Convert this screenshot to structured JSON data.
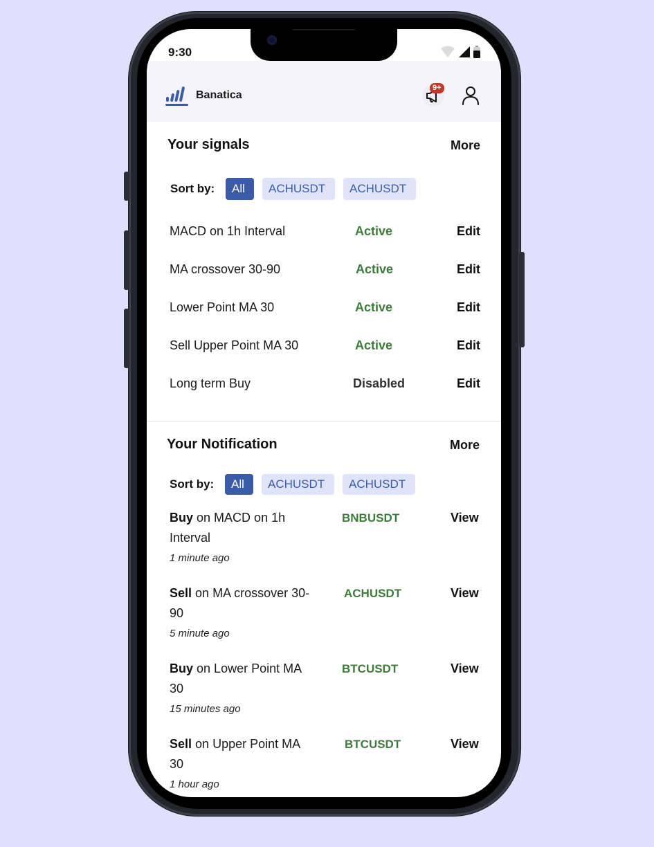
{
  "status_bar": {
    "time": "9:30"
  },
  "header": {
    "brand": "Banatica",
    "notification_badge": "9+"
  },
  "signals": {
    "title": "Your signals",
    "more_label": "More",
    "sort_label": "Sort by:",
    "filters": [
      "All",
      "ACHUSDT",
      "ACHUSDT"
    ],
    "items": [
      {
        "name": "MACD on 1h Interval",
        "status": "Active",
        "action": "Edit"
      },
      {
        "name": "MA crossover 30-90",
        "status": "Active",
        "action": "Edit"
      },
      {
        "name": "Lower Point MA 30",
        "status": "Active",
        "action": "Edit"
      },
      {
        "name": "Sell Upper Point MA 30",
        "status": "Active",
        "action": "Edit"
      },
      {
        "name": "Long term Buy",
        "status": "Disabled",
        "action": "Edit"
      }
    ]
  },
  "notifications": {
    "title": "Your Notification",
    "more_label": "More",
    "sort_label": "Sort by:",
    "filters": [
      "All",
      "ACHUSDT",
      "ACHUSDT"
    ],
    "items": [
      {
        "side": "Buy",
        "text": "on MACD on 1h Interval",
        "time": "1 minute ago",
        "pair": "BNBUSDT",
        "action": "View"
      },
      {
        "side": "Sell",
        "text": "on MA crossover 30-90",
        "time": "5 minute ago",
        "pair": "ACHUSDT",
        "action": "View"
      },
      {
        "side": "Buy",
        "text": "on Lower Point MA 30",
        "time": "15 minutes ago",
        "pair": "BTCUSDT",
        "action": "View"
      },
      {
        "side": "Sell",
        "text": "on Upper Point MA 30",
        "time": "1 hour ago",
        "pair": "BTCUSDT",
        "action": "View"
      }
    ]
  },
  "colors": {
    "background": "#dde1fb",
    "accent": "#3b5ba8",
    "chip_inactive": "#dfe4fb",
    "active_status": "#3e7a3a",
    "badge": "#c0392b"
  }
}
